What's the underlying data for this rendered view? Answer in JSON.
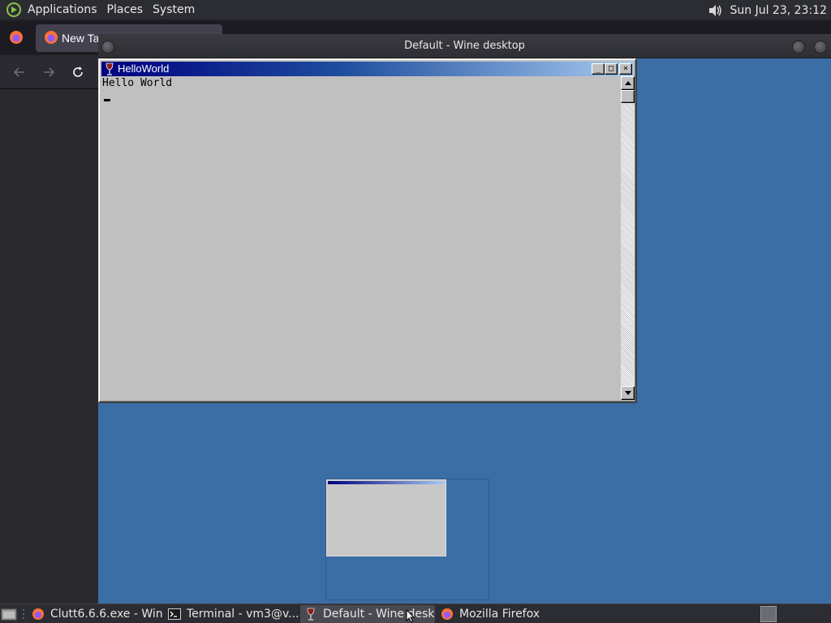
{
  "top_panel": {
    "menus": [
      "Applications",
      "Places",
      "System"
    ],
    "clock": "Sun Jul 23, 23:12"
  },
  "firefox": {
    "tab_title": "New Ta"
  },
  "wine_window": {
    "title": "Default - Wine desktop"
  },
  "helloworld": {
    "title": "HelloWorld",
    "text": "Hello World",
    "buttons": {
      "minimize": "_",
      "maximize": "□",
      "close": "×"
    }
  },
  "taskbar": {
    "tasks": [
      {
        "label": "Clutt6.6.6.exe - Win...",
        "icon": "firefox-icon"
      },
      {
        "label": "Terminal - vm3@v...",
        "icon": "terminal-icon"
      },
      {
        "label": "Default - Wine desk...",
        "icon": "wine-icon",
        "active": true
      },
      {
        "label": "Mozilla Firefox",
        "icon": "firefox-icon"
      }
    ]
  },
  "colors": {
    "wine_desktop": "#3a6ea5",
    "win95_face": "#c0c0c0",
    "active_title": "#000080"
  }
}
